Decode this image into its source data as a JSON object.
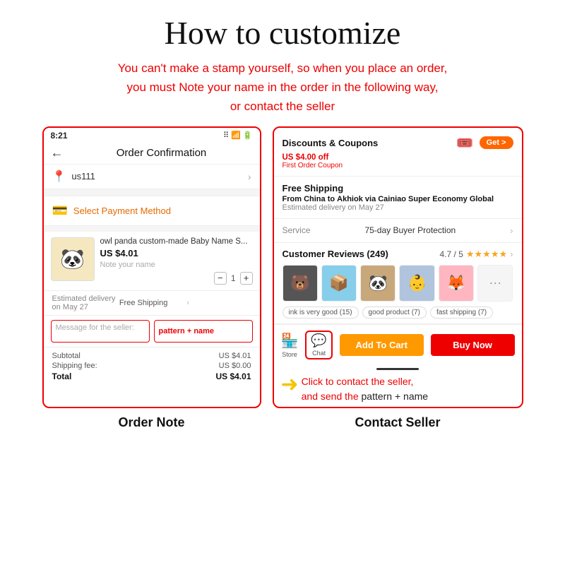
{
  "title": "How to customize",
  "subtitle_lines": [
    "You can't make a stamp yourself, so when you place an order,",
    "you must Note your name in the order in the following way,",
    "or contact the seller"
  ],
  "left_panel": {
    "time": "8:21",
    "signal_icons": "🔋",
    "nav_title": "Order Confirmation",
    "location": "us111",
    "payment": "Select Payment Method",
    "product_name": "owl panda custom-made Baby Name S...",
    "product_price": "US $4.01",
    "product_note": "Note your name",
    "product_qty": "1",
    "delivery": "Estimated delivery on May 27",
    "free_shipping": "Free Shipping",
    "message_placeholder": "Message for the seller:",
    "note_text": "pattern + name",
    "subtotal_label": "Subtotal",
    "subtotal_value": "US $4.01",
    "shipping_label": "Shipping fee:",
    "shipping_value": "US $0.00",
    "total_label": "Total",
    "total_value": "US $4.01"
  },
  "right_panel": {
    "discount_label": "Discounts & Coupons",
    "get_btn": "Get >",
    "discount_amount": "US $4.00 off",
    "discount_sub": "First Order Coupon",
    "shipping_title": "Free Shipping",
    "shipping_desc_1": "From",
    "from": "China",
    "shipping_desc_2": "to",
    "to": "Akhiok",
    "shipping_desc_3": "via Cainiao Super Economy Global",
    "delivery_est": "Estimated delivery on May 27",
    "service_label": "Service",
    "service_value": "75-day Buyer Protection",
    "reviews_title": "Customer Reviews (249)",
    "rating": "4.7 / 5",
    "review_tags": [
      "ink is very good (15)",
      "good product (7)",
      "fast shipping (7)"
    ],
    "store_label": "Store",
    "chat_label": "Chat",
    "add_cart_btn": "Add To Cart",
    "buy_now_btn": "Buy Now",
    "annotation_line1": "Click to contact the seller,",
    "annotation_line2": "and send the",
    "annotation_inline": "pattern + name"
  },
  "left_label": "Order Note",
  "right_label": "Contact Seller"
}
